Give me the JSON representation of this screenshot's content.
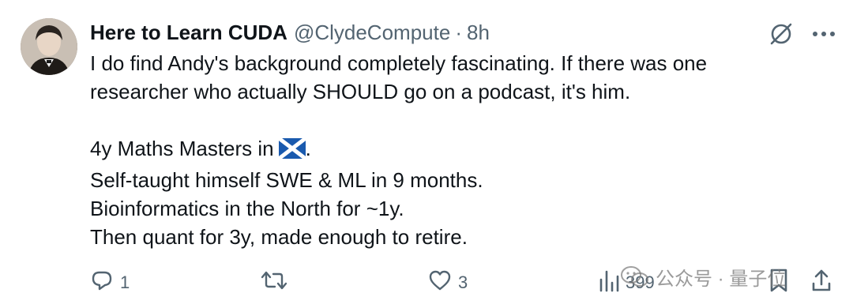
{
  "author": {
    "display_name": "Here to Learn CUDA",
    "handle": "@ClydeCompute",
    "separator": "·",
    "timestamp": "8h"
  },
  "header_icons": [
    "grok-icon",
    "more-icon"
  ],
  "tweet": {
    "line1": "I do find Andy's background completely fascinating. If there was one",
    "line2": "researcher who actually SHOULD go on a podcast, it's him.",
    "line3_text": "4y Maths Masters in",
    "line3_flag": "scotland-flag",
    "line3_end": ".",
    "line4": "Self-taught himself SWE & ML in 9 months.",
    "line5": "Bioinformatics in the North for ~1y.",
    "line6": "Then quant for 3y, made enough to retire."
  },
  "actions": {
    "reply_count": "1",
    "retweet_count": "",
    "like_count": "3",
    "views_count": "399"
  },
  "watermark": {
    "text": "公众号 · 量子位"
  },
  "colors": {
    "text": "#0f1419",
    "secondary": "#536471",
    "flag_blue": "#1a5aae",
    "background": "#ffffff"
  }
}
